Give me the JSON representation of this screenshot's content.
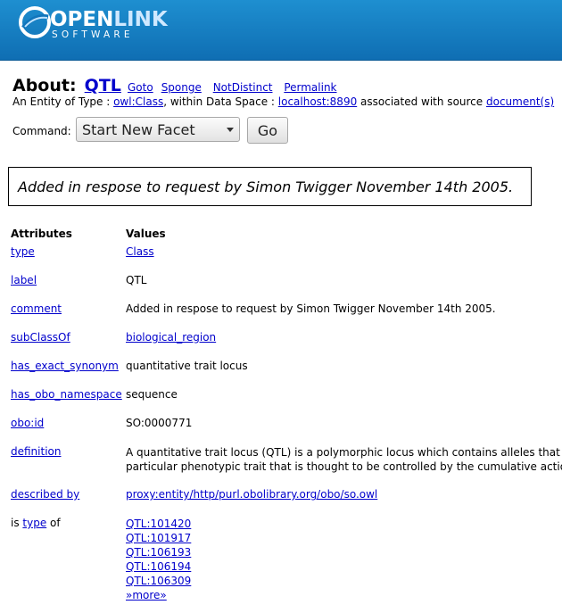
{
  "header": {
    "logo_open": "OPEN",
    "logo_link": "LINK",
    "logo_software": "SOFTWARE"
  },
  "about": {
    "label": "About:",
    "title": "QTL",
    "links": [
      "Goto",
      "Sponge",
      "NotDistinct",
      "Permalink"
    ],
    "entity_prefix": "An Entity of Type : ",
    "entity_type": "owl:Class",
    "entity_mid": ", within Data Space : ",
    "data_space": "localhost:8890",
    "entity_suffix": " associated with source ",
    "source": "document(s)"
  },
  "command": {
    "label": "Command:",
    "selected": "Start New Facet",
    "go": "Go"
  },
  "comment_box": "Added in respose to request by Simon Twigger November 14th 2005.",
  "table": {
    "headers": {
      "attributes": "Attributes",
      "values": "Values"
    },
    "rows": {
      "type": {
        "attr": "type",
        "value": "Class"
      },
      "label": {
        "attr": "label",
        "value": "QTL"
      },
      "comment": {
        "attr": "comment",
        "value": "Added in respose to request by Simon Twigger November 14th 2005."
      },
      "subClassOf": {
        "attr": "subClassOf",
        "value": "biological_region"
      },
      "has_exact_synonym": {
        "attr": "has_exact_synonym",
        "value": "quantitative trait locus"
      },
      "has_obo_namespace": {
        "attr": "has_obo_namespace",
        "value": "sequence"
      },
      "obo_id": {
        "attr": "obo:id",
        "value": "SO:0000771"
      },
      "definition": {
        "attr": "definition",
        "line1": "A quantitative trait locus (QTL) is a polymorphic locus which contains alleles that d",
        "line2": "particular phenotypic trait that is thought to be controlled by the cumulative actio"
      },
      "described_by": {
        "attr": "described by",
        "value": "proxy:entity/http/purl.obolibrary.org/obo/so.owl"
      },
      "is_type_of": {
        "prefix": "is ",
        "link": "type",
        "suffix": " of",
        "values": [
          "QTL:101420",
          "QTL:101917",
          "QTL:106193",
          "QTL:106194",
          "QTL:106309"
        ],
        "more": "»more»"
      }
    }
  }
}
